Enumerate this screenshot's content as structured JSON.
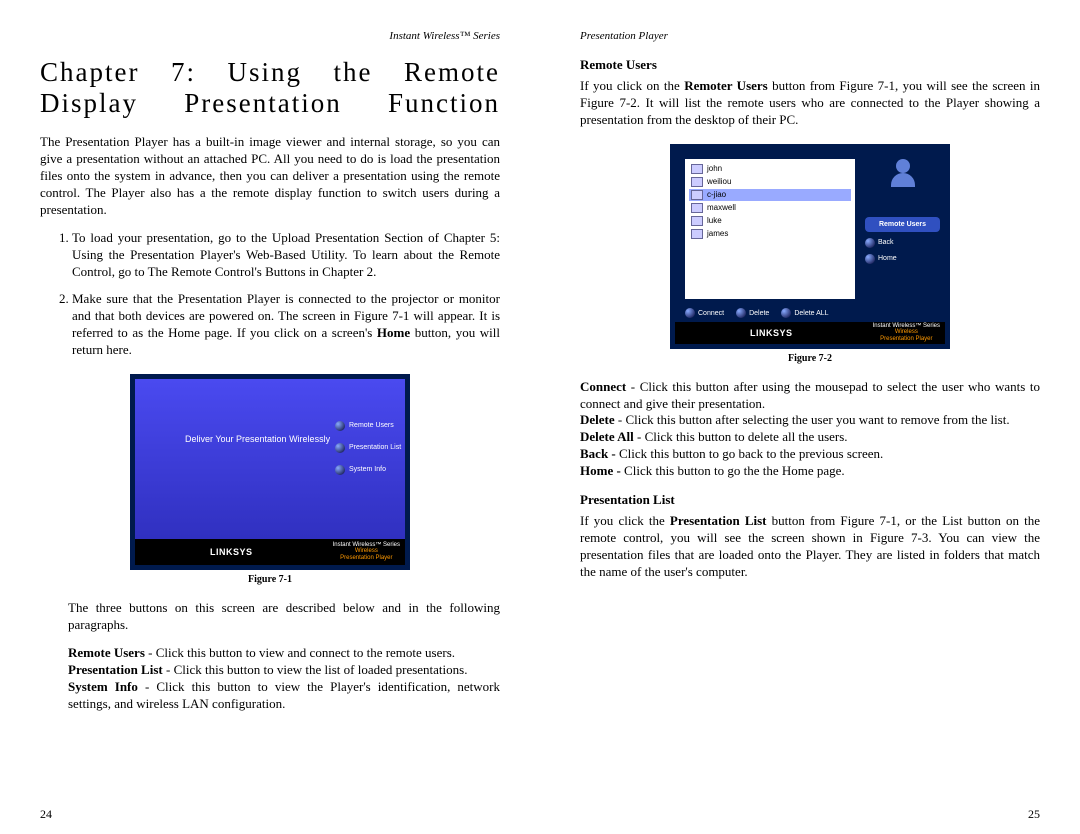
{
  "left": {
    "header": "Instant Wireless™ Series",
    "chapter_title": "Chapter 7: Using the Remote Display Presentation Function",
    "intro": "The Presentation Player has a built-in image viewer and internal storage, so you can give a presentation without an attached PC. All you need to do is load the presentation files onto the system in advance, then you can deliver a presentation using the remote control.  The Player also has a the remote display function to switch users during a presentation.",
    "step1": "To load your presentation, go to the Upload Presentation Section of Chapter 5: Using the Presentation Player's Web-Based Utility. To learn about the Remote Control, go to The Remote Control's Buttons in Chapter 2.",
    "step2_a": "Make sure that the Presentation Player is connected to the projector or monitor and that both devices are powered on. The screen in Figure 7-1 will appear. It is referred to as the Home page. If you click on a screen's ",
    "step2_bold": "Home",
    "step2_b": " button, you will return here.",
    "figure71": {
      "tagline": "Deliver Your Presentation Wirelessly",
      "btn1": "Remote Users",
      "btn2": "Presentation List",
      "btn3": "System Info",
      "logo": "LINKSYS",
      "series": "Instant Wireless™ Series",
      "product1": "Wireless",
      "product2": "Presentation Player",
      "caption": "Figure 7-1"
    },
    "three_buttons": "The three buttons on this screen are described below and in the following paragraphs.",
    "ru_label": "Remote Users",
    "ru_text": " - Click this button to view and connect to the remote users.",
    "pl_label": "Presentation List",
    "pl_text": " - Click this button to view the list of loaded presentations.",
    "si_label": "System Info",
    "si_text": " -  Click this button to view the Player's identification, network settings, and wireless LAN configuration.",
    "page_num": "24"
  },
  "right": {
    "header": "Presentation Player",
    "heading1": "Remote Users",
    "p1_a": "If you click on the ",
    "p1_bold": "Remoter Users",
    "p1_b": " button from Figure 7-1, you will see the screen in Figure 7-2. It will list the remote users who are connected to the Player showing a presentation from the desktop of their PC.",
    "figure72": {
      "users": [
        "john",
        "weiliou",
        "c-jiao",
        "maxwell",
        "luke",
        "james"
      ],
      "selected_index": 2,
      "side_title": "Remote Users",
      "back": "Back",
      "home": "Home",
      "connect": "Connect",
      "delete": "Delete",
      "delete_all": "Delete ALL",
      "logo": "LINKSYS",
      "series": "Instant Wireless™ Series",
      "product1": "Wireless",
      "product2": "Presentation Player",
      "caption": "Figure 7-2"
    },
    "connect_label": "Connect",
    "connect_text": " - Click this button after using the mousepad to select the user who wants to connect and give their presentation.",
    "delete_label": "Delete",
    "delete_text": " - Click this button after selecting the user you want to remove from the list.",
    "delete_all_label": "Delete All",
    "delete_all_text": " -  Click this button to delete all the users.",
    "back_label": "Back - ",
    "back_text": "Click this button to go back to the previous screen.",
    "home_label": "Home - ",
    "home_text": "Click this button to go the the Home page.",
    "heading2": "Presentation List",
    "p2_a": "If you click the ",
    "p2_bold": "Presentation List",
    "p2_b": " button from Figure 7-1, or the List button on the remote control, you will see the screen shown in Figure 7-3. You can view the presentation files that are loaded onto the Player. They are listed in folders that match the name of the user's computer.",
    "page_num": "25"
  }
}
